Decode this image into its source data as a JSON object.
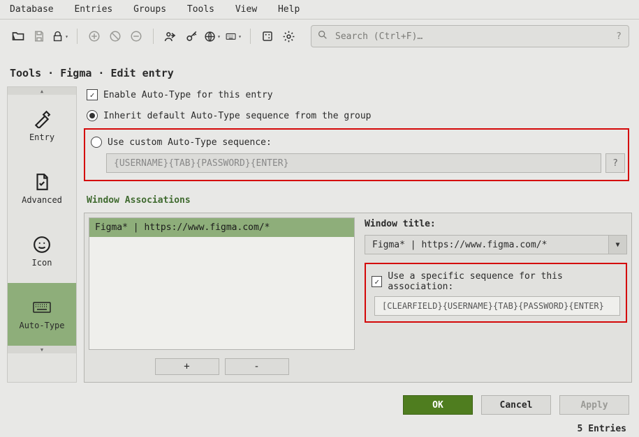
{
  "menu": [
    "Database",
    "Entries",
    "Groups",
    "Tools",
    "View",
    "Help"
  ],
  "search": {
    "placeholder": "Search (Ctrl+F)…"
  },
  "toolbar_icons": [
    "folder-open",
    "save",
    "lock dropdown",
    "add",
    "cancel",
    "delete",
    "person-share",
    "key",
    "globe dropdown",
    "keyboard dropdown",
    "dice",
    "gear"
  ],
  "breadcrumb": "Tools · Figma · Edit entry",
  "sidebar": {
    "items": [
      {
        "key": "entry",
        "label": "Entry"
      },
      {
        "key": "advanced",
        "label": "Advanced"
      },
      {
        "key": "icon",
        "label": "Icon"
      },
      {
        "key": "autotype",
        "label": "Auto-Type"
      }
    ]
  },
  "form": {
    "enable_label": "Enable Auto-Type for this entry",
    "inherit_label": "Inherit default Auto-Type sequence from the group",
    "custom_label": "Use custom Auto-Type sequence:",
    "custom_value": "{USERNAME}{TAB}{PASSWORD}{ENTER}",
    "window_assoc_head": "Window Associations",
    "list_item": "Figma*  |  https://www.figma.com/*",
    "plus": "+",
    "minus": "-",
    "window_title_label": "Window title:",
    "window_title_value": "Figma*  |  https://www.figma.com/*",
    "specific_label": "Use a specific sequence for this association:",
    "specific_value": "[CLEARFIELD}{USERNAME}{TAB}{PASSWORD}{ENTER}"
  },
  "buttons": {
    "ok": "OK",
    "cancel": "Cancel",
    "apply": "Apply"
  },
  "status": "5 Entries"
}
